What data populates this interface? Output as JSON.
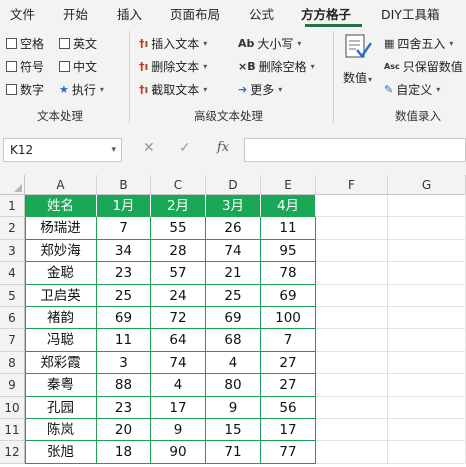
{
  "tabs": {
    "items": [
      "文件",
      "开始",
      "插入",
      "页面布局",
      "公式",
      "方方格子",
      "DIY工具箱"
    ],
    "active": "方方格子"
  },
  "ribbon": {
    "text_group": {
      "checkboxes": [
        "空格",
        "英文",
        "符号",
        "中文",
        "数字"
      ],
      "execute_label": "执行",
      "label": "文本处理"
    },
    "advanced_group": {
      "items": [
        "插入文本",
        "删除文本",
        "截取文本",
        "大小写",
        "删除空格",
        "更多"
      ],
      "label": "高级文本处理"
    },
    "numeric_group": {
      "value_label": "数值",
      "items": [
        "四舍五入",
        "只保留数值",
        "自定义"
      ],
      "label": "数值录入"
    }
  },
  "formula_bar": {
    "name_box": "K12",
    "cancel_icon": "✕",
    "enter_icon": "✓",
    "fx_label": "fx",
    "formula": ""
  },
  "sheet": {
    "columns": [
      "A",
      "B",
      "C",
      "D",
      "E",
      "F",
      "G"
    ],
    "rows": [
      "1",
      "2",
      "3",
      "4",
      "5",
      "6",
      "7",
      "8",
      "9",
      "10",
      "11",
      "12"
    ],
    "header_row": [
      "姓名",
      "1月",
      "2月",
      "3月",
      "4月"
    ],
    "data": [
      [
        "杨瑞进",
        "7",
        "55",
        "26",
        "11"
      ],
      [
        "郑妙海",
        "34",
        "28",
        "74",
        "95"
      ],
      [
        "金聪",
        "23",
        "57",
        "21",
        "78"
      ],
      [
        "卫启英",
        "25",
        "24",
        "25",
        "69"
      ],
      [
        "褚韵",
        "69",
        "72",
        "69",
        "100"
      ],
      [
        "冯聪",
        "11",
        "64",
        "68",
        "7"
      ],
      [
        "郑彩霞",
        "3",
        "74",
        "4",
        "27"
      ],
      [
        "秦粤",
        "88",
        "4",
        "80",
        "27"
      ],
      [
        "孔园",
        "23",
        "17",
        "9",
        "56"
      ],
      [
        "陈岚",
        "20",
        "9",
        "15",
        "17"
      ],
      [
        "张旭",
        "18",
        "90",
        "71",
        "77"
      ]
    ],
    "header_color": "#1aa756",
    "border_color": "#1e9e58"
  }
}
